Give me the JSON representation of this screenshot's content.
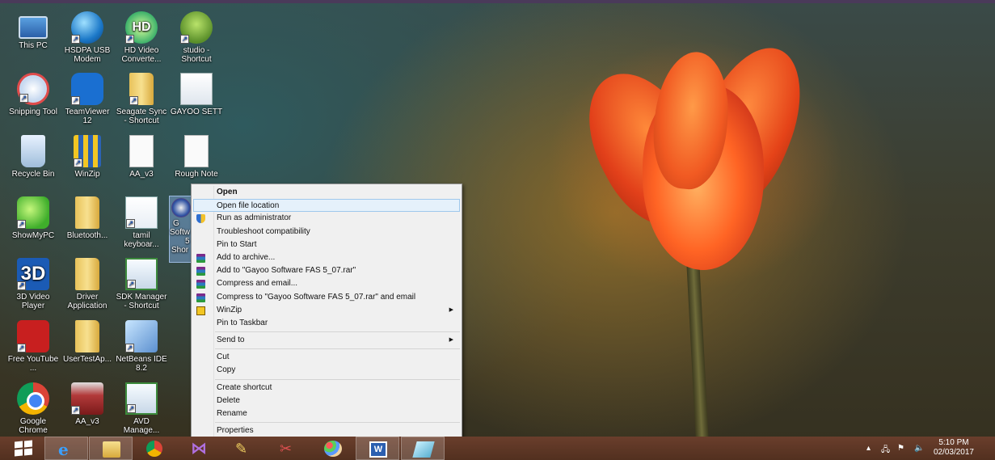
{
  "desktop": {
    "icons": [
      {
        "label": "This PC",
        "icon": "pc-icon"
      },
      {
        "label": "HSDPA USB Modem",
        "icon": "globe-icon"
      },
      {
        "label": "HD Video Converte...",
        "icon": "hd-video-icon"
      },
      {
        "label": "studio - Shortcut",
        "icon": "android-studio-icon"
      },
      {
        "label": "Snipping Tool",
        "icon": "scissors-icon"
      },
      {
        "label": "TeamViewer 12",
        "icon": "teamviewer-icon"
      },
      {
        "label": "Seagate Sync - Shortcut",
        "icon": "folder-icon"
      },
      {
        "label": "GAYOO SETT",
        "icon": "presentation-icon"
      },
      {
        "label": "Recycle Bin",
        "icon": "recycle-bin-icon"
      },
      {
        "label": "WinZip",
        "icon": "winzip-icon"
      },
      {
        "label": "AA_v3",
        "icon": "document-icon"
      },
      {
        "label": "Rough Note",
        "icon": "document-icon"
      },
      {
        "label": "ShowMyPC",
        "icon": "showmypc-icon"
      },
      {
        "label": "Bluetooth...",
        "icon": "folder-icon"
      },
      {
        "label": "tamil keyboar...",
        "icon": "word-document-icon"
      },
      {
        "label": "3D Video Player",
        "icon": "3d-video-icon"
      },
      {
        "label": "Driver Application",
        "icon": "folder-icon"
      },
      {
        "label": "SDK Manager - Shortcut",
        "icon": "sdk-manager-icon"
      },
      {
        "label": "Free YouTube ...",
        "icon": "youtube-downloader-icon"
      },
      {
        "label": "UserTestAp...",
        "icon": "folder-icon"
      },
      {
        "label": "NetBeans IDE 8.2",
        "icon": "netbeans-icon"
      },
      {
        "label": "Google Chrome",
        "icon": "chrome-icon"
      },
      {
        "label": "AA_v3",
        "icon": "autocad-icon"
      },
      {
        "label": "AVD Manage...",
        "icon": "avd-manager-icon"
      }
    ],
    "selected_icon_partial_label": [
      "G",
      "Softw",
      "5",
      "Shor"
    ]
  },
  "context_menu": {
    "items": [
      {
        "label": "Open",
        "bold": true
      },
      {
        "label": "Open file location",
        "hover": true
      },
      {
        "label": "Run as administrator",
        "icon": "uac-shield-icon"
      },
      {
        "label": "Troubleshoot compatibility"
      },
      {
        "label": "Pin to Start"
      },
      {
        "label": "Add to archive...",
        "icon": "winrar-icon"
      },
      {
        "label": "Add to \"Gayoo Software FAS 5_07.rar\"",
        "icon": "winrar-icon"
      },
      {
        "label": "Compress and email...",
        "icon": "winrar-icon"
      },
      {
        "label": "Compress to \"Gayoo Software FAS 5_07.rar\" and email",
        "icon": "winrar-icon"
      },
      {
        "label": "WinZip",
        "icon": "winzip-icon",
        "submenu": true
      },
      {
        "label": "Pin to Taskbar"
      },
      {
        "label": "Send to",
        "submenu": true,
        "separator_before": true
      },
      {
        "label": "Cut",
        "separator_before": true
      },
      {
        "label": "Copy"
      },
      {
        "label": "Create shortcut",
        "separator_before": true
      },
      {
        "label": "Delete"
      },
      {
        "label": "Rename"
      },
      {
        "label": "Properties",
        "separator_before": true
      }
    ]
  },
  "taskbar": {
    "start_icon": "windows-logo-icon",
    "items": [
      {
        "icon": "internet-explorer-icon",
        "active": true
      },
      {
        "icon": "file-explorer-icon",
        "active": true
      },
      {
        "icon": "chrome-icon"
      },
      {
        "icon": "visual-studio-icon"
      },
      {
        "icon": "tools-icon"
      },
      {
        "icon": "scissors-icon"
      },
      {
        "icon": "paint-icon"
      },
      {
        "icon": "word-icon",
        "active": true
      },
      {
        "icon": "app-icon",
        "active": true
      }
    ],
    "tray": {
      "chevron": "▴",
      "network_icon": "network-icon",
      "flag_icon": "action-center-flag-icon",
      "volume_icon": "speaker-icon"
    },
    "clock": {
      "time": "5:10 PM",
      "date": "02/03/2017"
    }
  },
  "colors": {
    "menu_hover": "#e5f1fb",
    "taskbar": "#5e3726",
    "tulip": "#f05a22"
  }
}
